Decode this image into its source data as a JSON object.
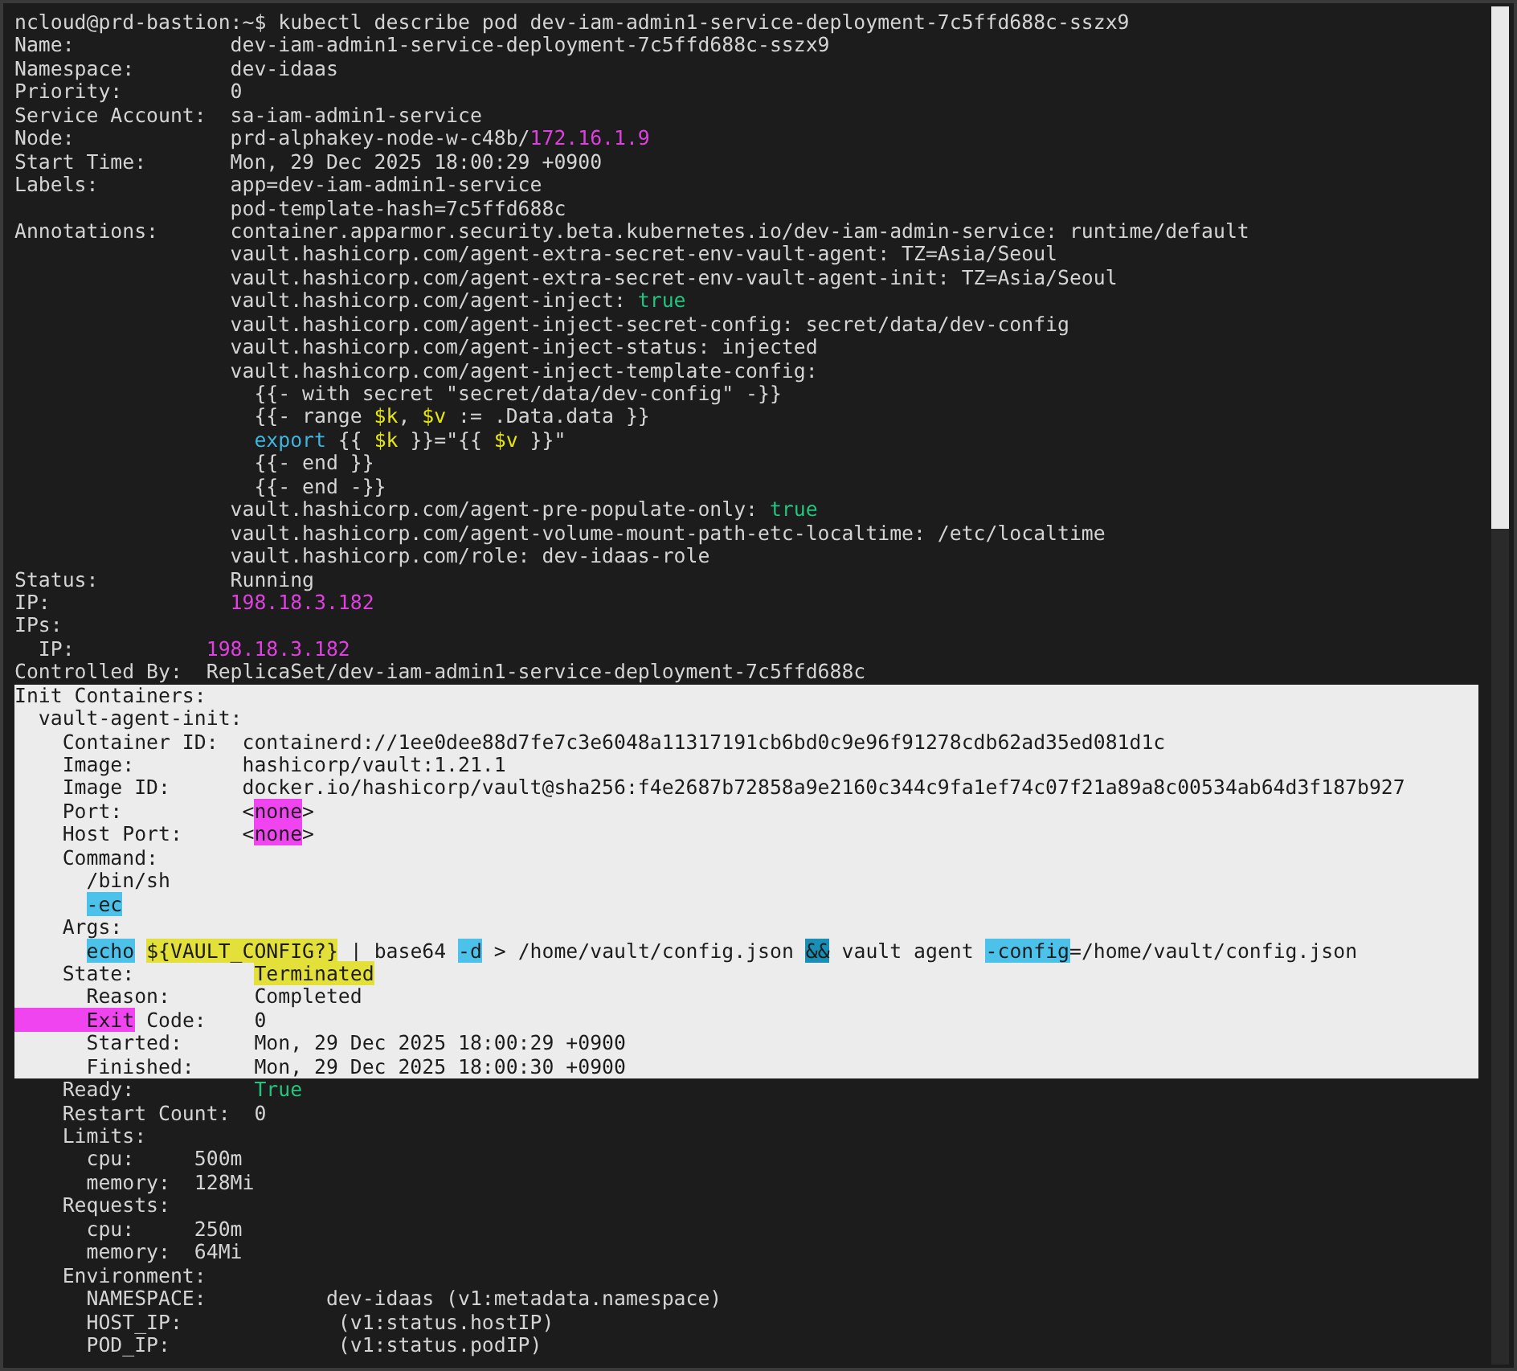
{
  "terminal": {
    "lines": [
      {
        "text": "ncloud@prd-bastion:~$ kubectl describe pod dev-iam-admin1-service-deployment-7c5ffd688c-sszx9",
        "selected": false
      },
      {
        "text": "Name:             dev-iam-admin1-service-deployment-7c5ffd688c-sszx9",
        "selected": false
      },
      {
        "text": "Namespace:        dev-idaas",
        "selected": false
      },
      {
        "text": "Priority:         0",
        "selected": false
      },
      {
        "text": "Service Account:  sa-iam-admin1-service",
        "selected": false
      },
      {
        "segments": [
          {
            "text": "Node:             prd-alphakey-node-w-c48b/",
            "kind": "plain"
          },
          {
            "text": "172.16.1.9",
            "kind": "magenta"
          }
        ],
        "selected": false
      },
      {
        "text": "Start Time:       Mon, 29 Dec 2025 18:00:29 +0900",
        "selected": false
      },
      {
        "text": "Labels:           app=dev-iam-admin1-service",
        "selected": false
      },
      {
        "text": "                  pod-template-hash=7c5ffd688c",
        "selected": false
      },
      {
        "text": "Annotations:      container.apparmor.security.beta.kubernetes.io/dev-iam-admin-service: runtime/default",
        "selected": false
      },
      {
        "text": "                  vault.hashicorp.com/agent-extra-secret-env-vault-agent: TZ=Asia/Seoul",
        "selected": false
      },
      {
        "text": "                  vault.hashicorp.com/agent-extra-secret-env-vault-agent-init: TZ=Asia/Seoul",
        "selected": false
      },
      {
        "segments": [
          {
            "text": "                  vault.hashicorp.com/agent-inject: ",
            "kind": "plain"
          },
          {
            "text": "true",
            "kind": "green"
          }
        ],
        "selected": false
      },
      {
        "text": "                  vault.hashicorp.com/agent-inject-secret-config: secret/data/dev-config",
        "selected": false
      },
      {
        "text": "                  vault.hashicorp.com/agent-inject-status: injected",
        "selected": false
      },
      {
        "text": "                  vault.hashicorp.com/agent-inject-template-config:",
        "selected": false
      },
      {
        "text": "                    {{- with secret \"secret/data/dev-config\" -}}",
        "selected": false
      },
      {
        "segments": [
          {
            "text": "                    {{- range ",
            "kind": "plain"
          },
          {
            "text": "$k",
            "kind": "yellow"
          },
          {
            "text": ", ",
            "kind": "plain"
          },
          {
            "text": "$v",
            "kind": "yellow"
          },
          {
            "text": " := .Data.data }}",
            "kind": "plain"
          }
        ],
        "selected": false
      },
      {
        "segments": [
          {
            "text": "                    export",
            "kind": "cyan"
          },
          {
            "text": " {{ ",
            "kind": "plain"
          },
          {
            "text": "$k",
            "kind": "yellow"
          },
          {
            "text": " }}=\"{{ ",
            "kind": "plain"
          },
          {
            "text": "$v",
            "kind": "yellow"
          },
          {
            "text": " }}\"",
            "kind": "plain"
          }
        ],
        "selected": false
      },
      {
        "text": "                    {{- end }}",
        "selected": false
      },
      {
        "text": "                    {{- end -}}",
        "selected": false
      },
      {
        "segments": [
          {
            "text": "                  vault.hashicorp.com/agent-pre-populate-only: ",
            "kind": "plain"
          },
          {
            "text": "true",
            "kind": "green"
          }
        ],
        "selected": false
      },
      {
        "text": "                  vault.hashicorp.com/agent-volume-mount-path-etc-localtime: /etc/localtime",
        "selected": false
      },
      {
        "text": "                  vault.hashicorp.com/role: dev-idaas-role",
        "selected": false
      },
      {
        "text": "Status:           Running",
        "selected": false
      },
      {
        "segments": [
          {
            "text": "IP:               ",
            "kind": "plain"
          },
          {
            "text": "198.18.3.182",
            "kind": "magenta"
          }
        ],
        "selected": false
      },
      {
        "text": "IPs:",
        "selected": false
      },
      {
        "segments": [
          {
            "text": "  IP:           ",
            "kind": "plain"
          },
          {
            "text": "198.18.3.182",
            "kind": "magenta"
          }
        ],
        "selected": false
      },
      {
        "text": "Controlled By:  ReplicaSet/dev-iam-admin1-service-deployment-7c5ffd688c",
        "selected": false
      },
      {
        "text": "Init Containers:",
        "selected": true
      },
      {
        "text": "  vault-agent-init:",
        "selected": true
      },
      {
        "text": "    Container ID:  containerd://1ee0dee88d7fe7c3e6048a11317191cb6bd0c9e96f91278cdb62ad35ed081d1c",
        "selected": true
      },
      {
        "text": "    Image:         hashicorp/vault:1.21.1",
        "selected": true
      },
      {
        "text": "    Image ID:      docker.io/hashicorp/vault@sha256:f4e2687b72858a9e2160c344c9fa1ef74c07f21a89a8c00534ab64d3f187b927",
        "selected": true
      },
      {
        "segments": [
          {
            "text": "    Port:          <",
            "kind": "plain"
          },
          {
            "text": "none",
            "kind": "magenta-hl"
          },
          {
            "text": ">",
            "kind": "plain"
          }
        ],
        "selected": true
      },
      {
        "segments": [
          {
            "text": "    Host Port:     <",
            "kind": "plain"
          },
          {
            "text": "none",
            "kind": "magenta-hl"
          },
          {
            "text": ">",
            "kind": "plain"
          }
        ],
        "selected": true
      },
      {
        "text": "    Command:",
        "selected": true
      },
      {
        "text": "      /bin/sh",
        "selected": true
      },
      {
        "segments": [
          {
            "text": "      -ec",
            "kind": "cyan-hl"
          }
        ],
        "selected": true
      },
      {
        "text": "    Args:",
        "selected": true
      },
      {
        "segments": [
          {
            "text": "      echo",
            "kind": "cyan-hl"
          },
          {
            "text": " ${VAULT_CONFIG?}",
            "kind": "yellow-hl"
          },
          {
            "text": " | base64 ",
            "kind": "plain"
          },
          {
            "text": "-d",
            "kind": "cyan-hl"
          },
          {
            "text": " > /home/vault/config.json ",
            "kind": "plain"
          },
          {
            "text": "&&",
            "kind": "teal-hl"
          },
          {
            "text": " vault agent ",
            "kind": "plain"
          },
          {
            "text": "-config",
            "kind": "cyan-hl"
          },
          {
            "text": "=/home/vault/config.json",
            "kind": "plain"
          }
        ],
        "selected": true
      },
      {
        "segments": [
          {
            "text": "    State:          ",
            "kind": "plain"
          },
          {
            "text": "Terminated",
            "kind": "yellow-hl"
          }
        ],
        "selected": true
      },
      {
        "text": "      Reason:       Completed",
        "selected": true
      },
      {
        "segments": [
          {
            "text": "      Exit",
            "kind": "magenta-block"
          },
          {
            "text": " Code:    0",
            "kind": "plain"
          }
        ],
        "selected": true
      },
      {
        "text": "      Started:      Mon, 29 Dec 2025 18:00:29 +0900",
        "selected": true
      },
      {
        "text": "      Finished:     Mon, 29 Dec 2025 18:00:30 +0900",
        "selected": true
      },
      {
        "segments": [
          {
            "text": "    Ready:          ",
            "kind": "plain"
          },
          {
            "text": "True",
            "kind": "green"
          }
        ],
        "selected": false
      },
      {
        "text": "    Restart Count:  0",
        "selected": false
      },
      {
        "text": "    Limits:",
        "selected": false
      },
      {
        "text": "      cpu:     500m",
        "selected": false
      },
      {
        "text": "      memory:  128Mi",
        "selected": false
      },
      {
        "text": "    Requests:",
        "selected": false
      },
      {
        "text": "      cpu:     250m",
        "selected": false
      },
      {
        "text": "      memory:  64Mi",
        "selected": false
      },
      {
        "text": "    Environment:",
        "selected": false
      },
      {
        "text": "      NAMESPACE:          dev-idaas (v1:metadata.namespace)",
        "selected": false
      },
      {
        "text": "      HOST_IP:             (v1:status.hostIP)",
        "selected": false
      },
      {
        "text": "      POD_IP:              (v1:status.podIP)",
        "selected": false
      }
    ]
  }
}
